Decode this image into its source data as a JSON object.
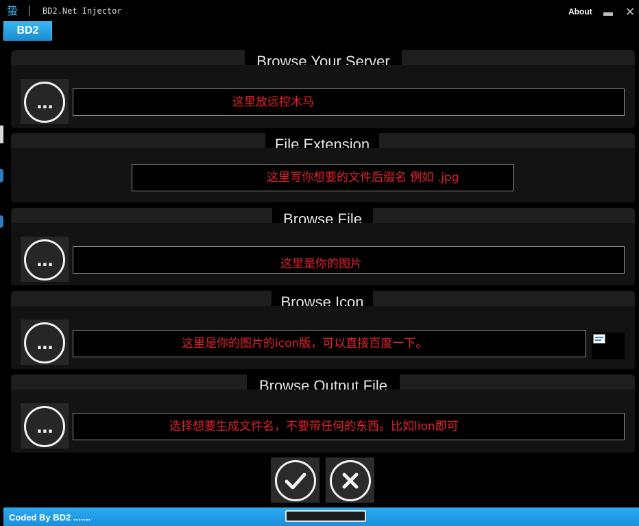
{
  "window": {
    "title": "BD2.Net Injector",
    "logo_glyph": "蛰",
    "about_label": "About",
    "tab_label": "BD2"
  },
  "panels": {
    "server": {
      "title": "Browse Your Server",
      "field_value": "这里放远控木马"
    },
    "extension": {
      "title": "File Extension",
      "field_value": "这里写你想要的文件后缀名 例如 .jpg"
    },
    "file": {
      "title": "Browse  File",
      "field_value": "这里是你的图片"
    },
    "icon": {
      "title": "Browse Icon",
      "field_value": "这里是你的图片的icon版，可以直接百度一下。"
    },
    "output": {
      "title": "Browse Output File",
      "field_value": "选择想要生成文件名，不要带任何的东西。比如lion即可"
    }
  },
  "browse_button_glyph": "...",
  "icons": {
    "browse": "ellipsis-icon",
    "confirm": "checkmark-icon",
    "cancel": "x-icon",
    "minimize": "minimize-icon",
    "close": "close-icon"
  },
  "status": {
    "text": "Coded By BD2 .......",
    "progress": 0
  },
  "colors": {
    "accent": "#1f98e0",
    "field_text": "#e8202a",
    "panel_bg": "#131313",
    "window_bg": "#000000"
  }
}
